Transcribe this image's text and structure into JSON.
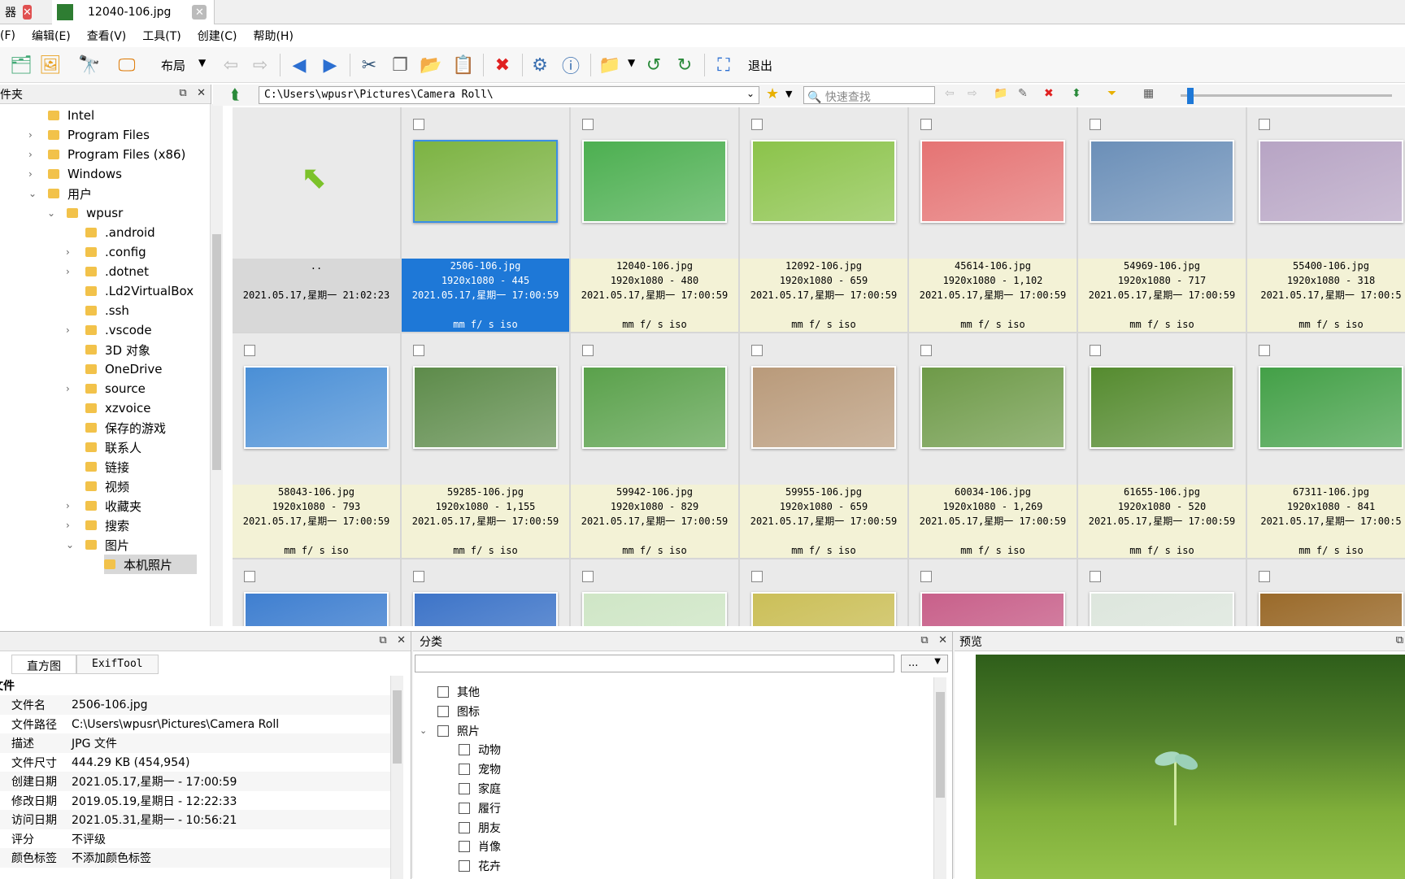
{
  "tabs": [
    {
      "label": "器"
    },
    {
      "label": "12040-106.jpg"
    }
  ],
  "menu": [
    "(F)",
    "编辑(E)",
    "查看(V)",
    "工具(T)",
    "创建(C)",
    "帮助(H)"
  ],
  "toolbar": {
    "layout_label": "布局",
    "exit_label": "退出"
  },
  "folder_panel": {
    "title": "文件夹",
    "items": [
      {
        "label": "Intel",
        "chev": ""
      },
      {
        "label": "Program Files",
        "chev": "›"
      },
      {
        "label": "Program Files (x86)",
        "chev": "›"
      },
      {
        "label": "Windows",
        "chev": "›"
      },
      {
        "label": "用户",
        "chev": "⌄"
      },
      {
        "label": "wpusr",
        "chev": "⌄"
      },
      {
        "label": ".android",
        "chev": ""
      },
      {
        "label": ".config",
        "chev": "›"
      },
      {
        "label": ".dotnet",
        "chev": "›"
      },
      {
        "label": ".Ld2VirtualBox",
        "chev": ""
      },
      {
        "label": ".ssh",
        "chev": ""
      },
      {
        "label": ".vscode",
        "chev": "›"
      },
      {
        "label": "3D 对象",
        "chev": ""
      },
      {
        "label": "OneDrive",
        "chev": ""
      },
      {
        "label": "source",
        "chev": "›"
      },
      {
        "label": "xzvoice",
        "chev": ""
      },
      {
        "label": "保存的游戏",
        "chev": ""
      },
      {
        "label": "联系人",
        "chev": ""
      },
      {
        "label": "链接",
        "chev": ""
      },
      {
        "label": "视频",
        "chev": ""
      },
      {
        "label": "收藏夹",
        "chev": "›"
      },
      {
        "label": "搜索",
        "chev": "›"
      },
      {
        "label": "图片",
        "chev": "⌄"
      },
      {
        "label": "本机照片",
        "chev": ""
      }
    ]
  },
  "address": {
    "path": "C:\\Users\\wpusr\\Pictures\\Camera Roll\\",
    "search_placeholder": "快速查找"
  },
  "grid": {
    "up_cell": {
      "label": "..",
      "date": "2021.05.17,星期一 21:02:23"
    },
    "row1": [
      {
        "name": "2506-106.jpg",
        "dims": "1920x1080 - 445",
        "date": "2021.05.17,星期一 17:00:59",
        "exif": "mm f/ s iso",
        "color": "#7cb342",
        "selected": true
      },
      {
        "name": "12040-106.jpg",
        "dims": "1920x1080 - 480",
        "date": "2021.05.17,星期一 17:00:59",
        "exif": "mm f/ s iso",
        "color": "#4caf50"
      },
      {
        "name": "12092-106.jpg",
        "dims": "1920x1080 - 659",
        "date": "2021.05.17,星期一 17:00:59",
        "exif": "mm f/ s iso",
        "color": "#8bc34a"
      },
      {
        "name": "45614-106.jpg",
        "dims": "1920x1080 - 1,102",
        "date": "2021.05.17,星期一 17:00:59",
        "exif": "mm f/ s iso",
        "color": "#e57373"
      },
      {
        "name": "54969-106.jpg",
        "dims": "1920x1080 - 717",
        "date": "2021.05.17,星期一 17:00:59",
        "exif": "mm f/ s iso",
        "color": "#6b8fb8"
      },
      {
        "name": "55400-106.jpg",
        "dims": "1920x1080 - 318",
        "date": "2021.05.17,星期一 17:00:5",
        "exif": "mm f/ s iso",
        "color": "#b7a4c4"
      }
    ],
    "row2": [
      {
        "name": "58043-106.jpg",
        "dims": "1920x1080 - 793",
        "date": "2021.05.17,星期一 17:00:59",
        "exif": "mm f/ s iso",
        "color": "#4a8fd6"
      },
      {
        "name": "59285-106.jpg",
        "dims": "1920x1080 - 1,155",
        "date": "2021.05.17,星期一 17:00:59",
        "exif": "mm f/ s iso",
        "color": "#5d8b4a"
      },
      {
        "name": "59942-106.jpg",
        "dims": "1920x1080 - 829",
        "date": "2021.05.17,星期一 17:00:59",
        "exif": "mm f/ s iso",
        "color": "#5aa14b"
      },
      {
        "name": "59955-106.jpg",
        "dims": "1920x1080 - 659",
        "date": "2021.05.17,星期一 17:00:59",
        "exif": "mm f/ s iso",
        "color": "#b99a7a"
      },
      {
        "name": "60034-106.jpg",
        "dims": "1920x1080 - 1,269",
        "date": "2021.05.17,星期一 17:00:59",
        "exif": "mm f/ s iso",
        "color": "#6e9a48"
      },
      {
        "name": "61655-106.jpg",
        "dims": "1920x1080 - 520",
        "date": "2021.05.17,星期一 17:00:59",
        "exif": "mm f/ s iso",
        "color": "#558b2f"
      },
      {
        "name": "67311-106.jpg",
        "dims": "1920x1080 - 841",
        "date": "2021.05.17,星期一 17:00:5",
        "exif": "mm f/ s iso",
        "color": "#43a047"
      }
    ],
    "row3": [
      {
        "color": "#3f7fd0"
      },
      {
        "color": "#3d74c8"
      },
      {
        "color": "#cfe6c6"
      },
      {
        "color": "#cbbf58"
      },
      {
        "color": "#c8608a"
      },
      {
        "color": "#dde6dd"
      },
      {
        "color": "#9a6a2a"
      }
    ]
  },
  "props": {
    "tabs": [
      "直方图",
      "ExifTool"
    ],
    "section": "文件",
    "rows": [
      {
        "k": "文件名",
        "v": "2506-106.jpg"
      },
      {
        "k": "文件路径",
        "v": "C:\\Users\\wpusr\\Pictures\\Camera Roll"
      },
      {
        "k": "描述",
        "v": "JPG 文件"
      },
      {
        "k": "文件尺寸",
        "v": "444.29 KB (454,954)"
      },
      {
        "k": "创建日期",
        "v": "2021.05.17,星期一 - 17:00:59"
      },
      {
        "k": "修改日期",
        "v": "2019.05.19,星期日 - 12:22:33"
      },
      {
        "k": "访问日期",
        "v": "2021.05.31,星期一 - 10:56:21"
      },
      {
        "k": "评分",
        "v": "不评级"
      },
      {
        "k": "颜色标签",
        "v": "不添加颜色标签"
      }
    ]
  },
  "categories": {
    "title": "分类",
    "dropdown": "...",
    "items": [
      {
        "label": "其他",
        "level": 0
      },
      {
        "label": "图标",
        "level": 0
      },
      {
        "label": "照片",
        "level": 0,
        "expanded": true
      },
      {
        "label": "动物",
        "level": 1
      },
      {
        "label": "宠物",
        "level": 1
      },
      {
        "label": "家庭",
        "level": 1
      },
      {
        "label": "履行",
        "level": 1
      },
      {
        "label": "朋友",
        "level": 1
      },
      {
        "label": "肖像",
        "level": 1
      },
      {
        "label": "花卉",
        "level": 1
      }
    ]
  },
  "preview": {
    "title": "预览"
  },
  "colors": {
    "selection": "#1e78d7",
    "accent": "#3a8ee6",
    "close_red": "#e05050"
  }
}
